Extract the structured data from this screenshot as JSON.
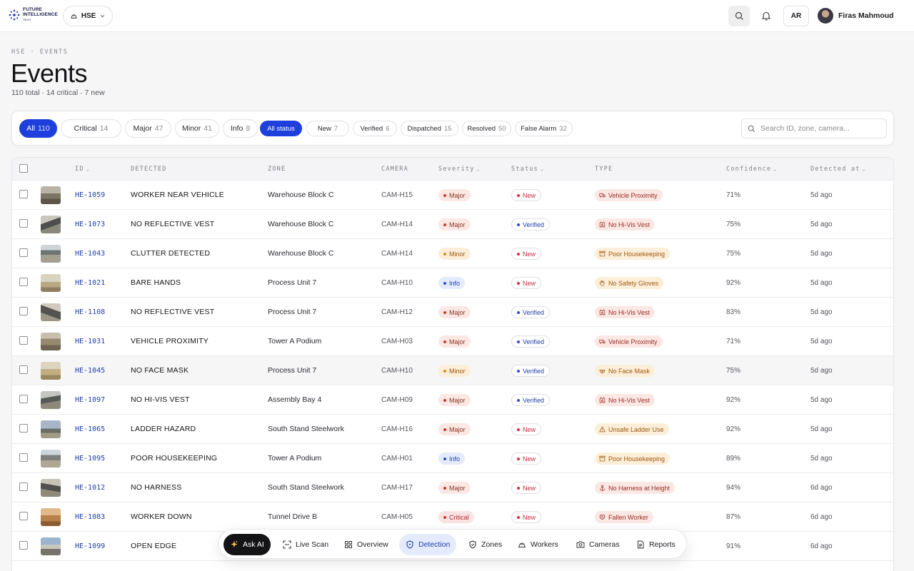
{
  "brand": {
    "line1": "FUTURE",
    "line2": "INTELLIGENCE",
    "line3": "TECH"
  },
  "workspace": {
    "label": "HSE"
  },
  "topbar": {
    "lang": "AR",
    "user_name": "Firas Mahmoud"
  },
  "breadcrumb": "HSE · EVENTS",
  "title": "Events",
  "subtitle": "110 total · 14 critical · 7 new",
  "severity_filters": [
    {
      "label": "All",
      "count": "110"
    },
    {
      "label": "Critical",
      "count": "14"
    },
    {
      "label": "Major",
      "count": "47"
    },
    {
      "label": "Minor",
      "count": "41"
    },
    {
      "label": "Info",
      "count": "8"
    }
  ],
  "status_filters": [
    {
      "label": "All status",
      "count": ""
    },
    {
      "label": "New",
      "count": "7"
    },
    {
      "label": "Verified",
      "count": "6"
    },
    {
      "label": "Dispatched",
      "count": "15"
    },
    {
      "label": "Resolved",
      "count": "50"
    },
    {
      "label": "False Alarm",
      "count": "32"
    }
  ],
  "search": {
    "placeholder": "Search ID, zone, camera..."
  },
  "columns": {
    "id": "ID",
    "detected": "DETECTED",
    "zone": "ZONE",
    "camera": "CAMERA",
    "severity": "Severity",
    "status": "Status",
    "type": "TYPE",
    "confidence": "Confidence",
    "detected_at": "Detected at"
  },
  "rows": [
    {
      "id": "HE-1059",
      "detected": "Worker near vehicle",
      "zone": "Warehouse Block C",
      "camera": "CAM-H15",
      "severity": "Major",
      "status": "New",
      "type": "Vehicle Proximity",
      "type_icon": "truck-icon",
      "confidence": "71%",
      "when": "5d ago"
    },
    {
      "id": "HE-1073",
      "detected": "No reflective vest",
      "zone": "Warehouse Block C",
      "camera": "CAM-H14",
      "severity": "Major",
      "status": "Verified",
      "type": "No Hi-Vis Vest",
      "type_icon": "vest-icon",
      "confidence": "75%",
      "when": "5d ago"
    },
    {
      "id": "HE-1043",
      "detected": "Clutter detected",
      "zone": "Warehouse Block C",
      "camera": "CAM-H14",
      "severity": "Minor",
      "status": "New",
      "type": "Poor Housekeeping",
      "type_icon": "box-icon",
      "confidence": "75%",
      "when": "5d ago"
    },
    {
      "id": "HE-1021",
      "detected": "Bare hands",
      "zone": "Process Unit 7",
      "camera": "CAM-H10",
      "severity": "Info",
      "status": "New",
      "type": "No Safety Gloves",
      "type_icon": "hand-icon",
      "confidence": "92%",
      "when": "5d ago"
    },
    {
      "id": "HE-1108",
      "detected": "No reflective vest",
      "zone": "Process Unit 7",
      "camera": "CAM-H12",
      "severity": "Major",
      "status": "Verified",
      "type": "No Hi-Vis Vest",
      "type_icon": "vest-icon",
      "confidence": "83%",
      "when": "5d ago"
    },
    {
      "id": "HE-1031",
      "detected": "Vehicle proximity",
      "zone": "Tower A Podium",
      "camera": "CAM-H03",
      "severity": "Major",
      "status": "Verified",
      "type": "Vehicle Proximity",
      "type_icon": "truck-icon",
      "confidence": "71%",
      "when": "5d ago"
    },
    {
      "id": "HE-1045",
      "detected": "No face mask",
      "zone": "Process Unit 7",
      "camera": "CAM-H10",
      "severity": "Minor",
      "status": "Verified",
      "type": "No Face Mask",
      "type_icon": "mask-icon",
      "confidence": "75%",
      "when": "5d ago"
    },
    {
      "id": "HE-1097",
      "detected": "No hi-vis vest",
      "zone": "Assembly Bay 4",
      "camera": "CAM-H09",
      "severity": "Major",
      "status": "Verified",
      "type": "No Hi-Vis Vest",
      "type_icon": "vest-icon",
      "confidence": "92%",
      "when": "5d ago"
    },
    {
      "id": "HE-1065",
      "detected": "Ladder hazard",
      "zone": "South Stand Steelwork",
      "camera": "CAM-H16",
      "severity": "Major",
      "status": "New",
      "type": "Unsafe Ladder Use",
      "type_icon": "warning-icon",
      "confidence": "92%",
      "when": "5d ago"
    },
    {
      "id": "HE-1095",
      "detected": "Poor housekeeping",
      "zone": "Tower A Podium",
      "camera": "CAM-H01",
      "severity": "Info",
      "status": "New",
      "type": "Poor Housekeeping",
      "type_icon": "box-icon",
      "confidence": "89%",
      "when": "5d ago"
    },
    {
      "id": "HE-1012",
      "detected": "No harness",
      "zone": "South Stand Steelwork",
      "camera": "CAM-H17",
      "severity": "Major",
      "status": "New",
      "type": "No Harness at Height",
      "type_icon": "anchor-icon",
      "confidence": "94%",
      "when": "6d ago"
    },
    {
      "id": "HE-1083",
      "detected": "Worker down",
      "zone": "Tunnel Drive B",
      "camera": "CAM-H05",
      "severity": "Critical",
      "status": "New",
      "type": "Fallen Worker",
      "type_icon": "heart-icon",
      "confidence": "87%",
      "when": "6d ago"
    },
    {
      "id": "HE-1099",
      "detected": "Open edge",
      "zone": "",
      "camera": "",
      "severity": "",
      "status": "",
      "type": "",
      "type_icon": "",
      "confidence": "91%",
      "when": "6d ago"
    }
  ],
  "dock": [
    {
      "label": "Ask AI",
      "icon": "sparkle-icon"
    },
    {
      "label": "Live Scan",
      "icon": "scan-icon"
    },
    {
      "label": "Overview",
      "icon": "grid-icon"
    },
    {
      "label": "Detection",
      "icon": "shield-icon"
    },
    {
      "label": "Zones",
      "icon": "shield-check-icon"
    },
    {
      "label": "Workers",
      "icon": "helmet-icon"
    },
    {
      "label": "Cameras",
      "icon": "camera-icon"
    },
    {
      "label": "Reports",
      "icon": "document-icon"
    }
  ],
  "colors": {
    "accent": "#1f3fdc",
    "link": "#1f3fa8",
    "critical": "#d6303a",
    "major": "#c53b26",
    "minor": "#d98a26"
  }
}
